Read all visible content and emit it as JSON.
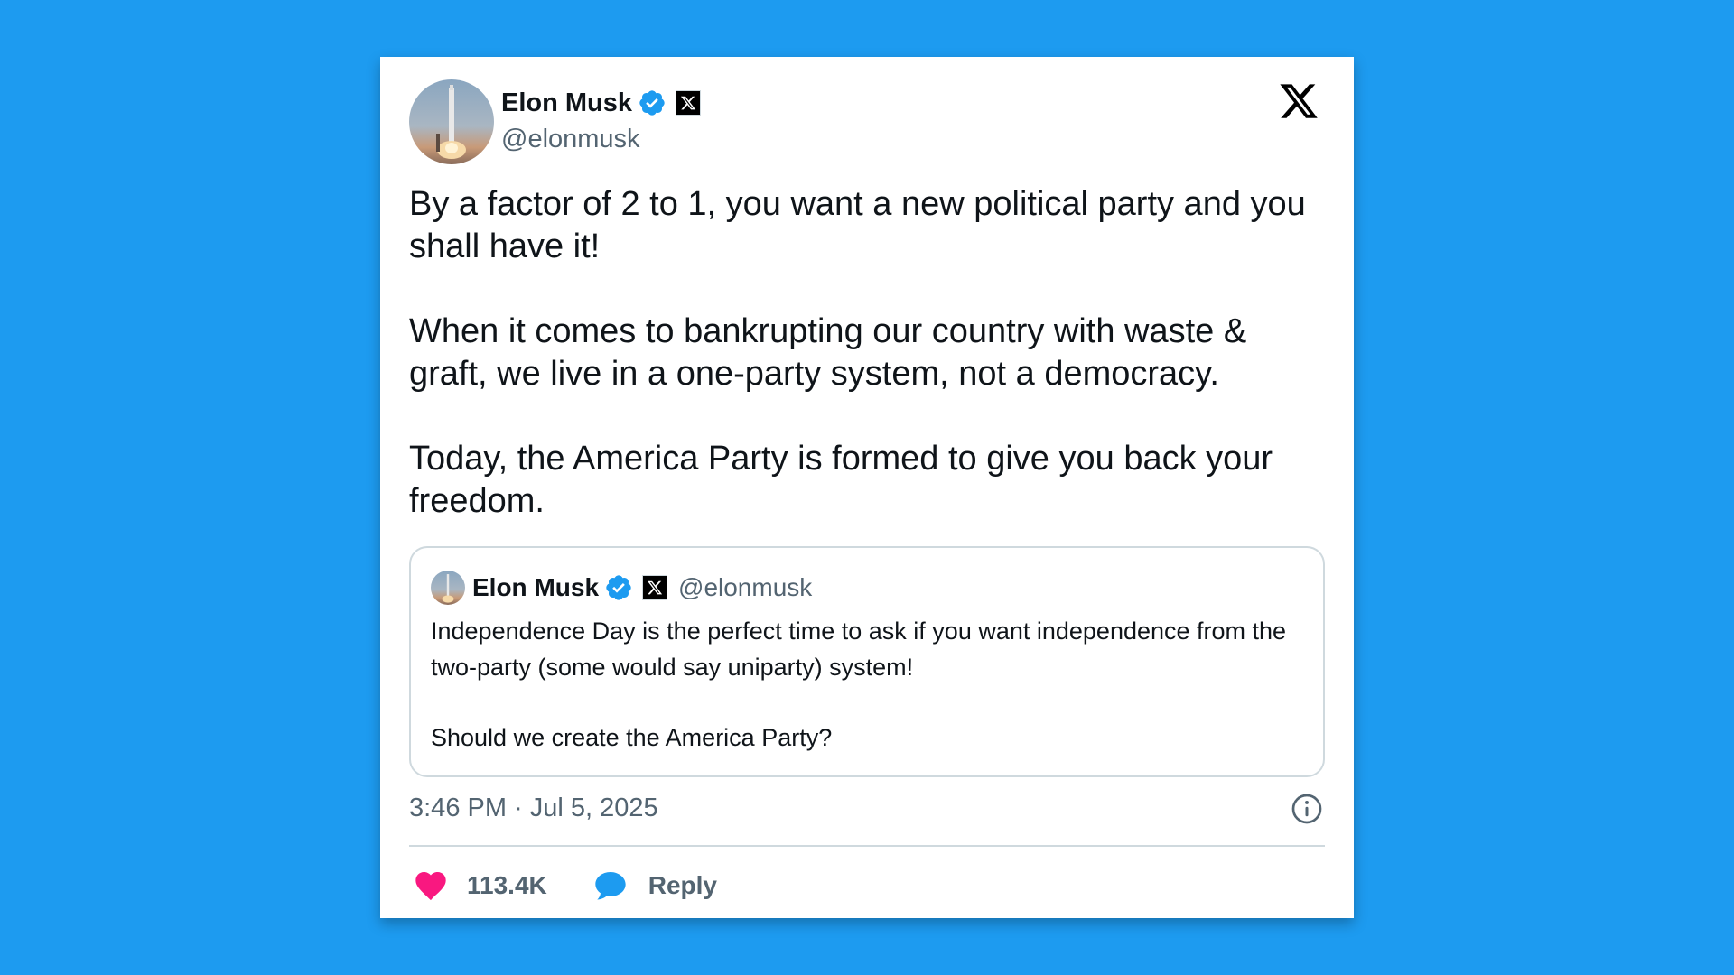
{
  "tweet": {
    "author_name": "Elon Musk",
    "handle": "@elonmusk",
    "paragraphs": [
      "By a factor of 2 to 1, you want a new political party and you shall have it!",
      "When it comes to bankrupting our country with waste & graft, we live in a one-party system, not a democracy.",
      "Today, the America Party is formed to give you back your freedom."
    ],
    "timestamp": "3:46 PM · Jul 5, 2025"
  },
  "quoted_tweet": {
    "author_name": "Elon Musk",
    "handle": "@elonmusk",
    "paragraphs": [
      "Independence Day is the perfect time to ask if you want independence from the two-party (some would say uniparty) system!",
      "Should we create the America Party?"
    ]
  },
  "actions": {
    "like_count": "113.4K",
    "reply_label": "Reply"
  },
  "icons": {
    "brand_logo": "x-logo-icon",
    "verified": "verified-badge-icon",
    "affiliation": "x-affiliate-badge-icon",
    "info": "info-icon",
    "like": "heart-icon",
    "reply": "reply-bubble-icon"
  },
  "colors": {
    "background": "#1d9bf0",
    "verified_blue": "#1d9bf0",
    "like_pink": "#f91880",
    "secondary_text": "#536471",
    "primary_text": "#0f1419"
  }
}
